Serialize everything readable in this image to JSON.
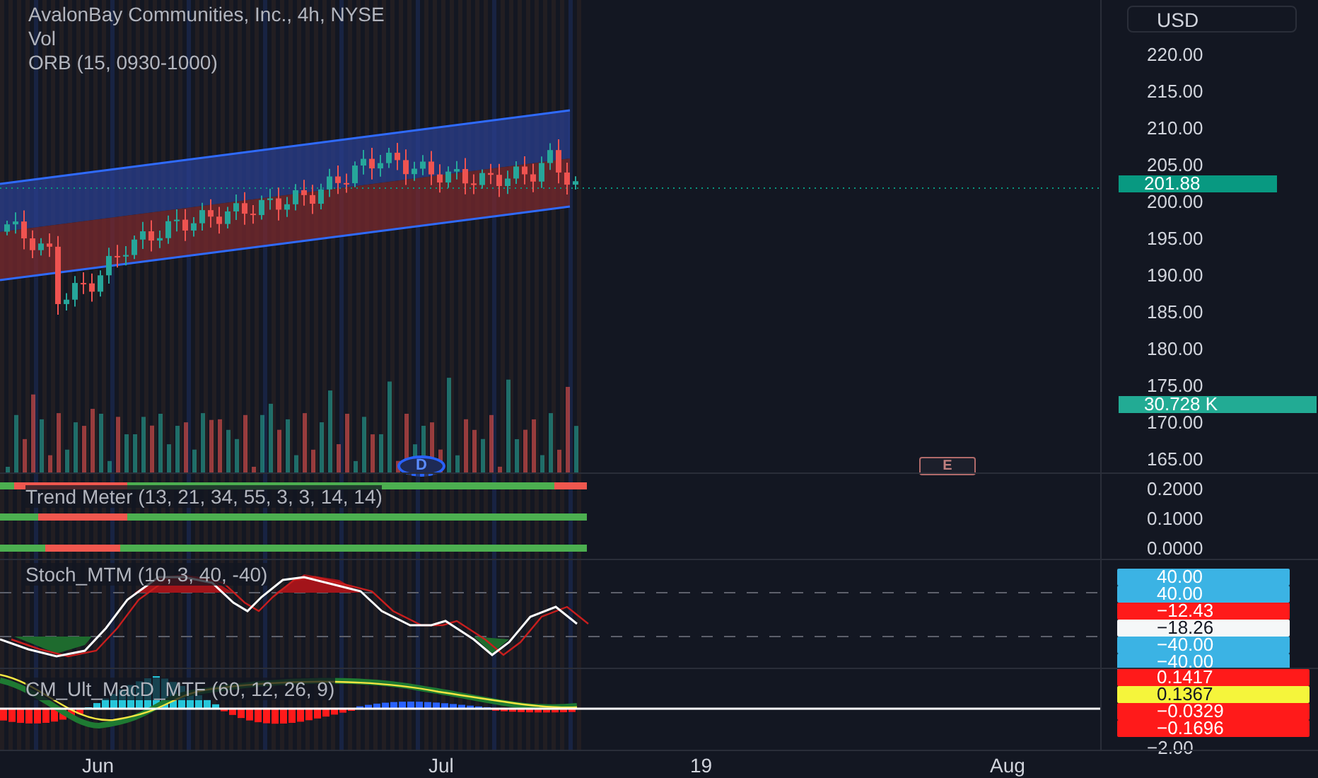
{
  "legend": {
    "title": "AvalonBay Communities, Inc., 4h, NYSE",
    "lines": [
      "Vol",
      "ORB (15, 0930-1000)"
    ]
  },
  "currency": "USD",
  "price_ticks": [
    "220.00",
    "215.00",
    "210.00",
    "205.00",
    "200.00",
    "195.00",
    "190.00",
    "185.00",
    "180.00",
    "175.00",
    "170.00",
    "165.00"
  ],
  "price_badges": [
    {
      "text": "201.88",
      "color": "#089981"
    },
    {
      "text": "30.728 K",
      "color": "#22ab94"
    }
  ],
  "markers": [
    {
      "kind": "dividend",
      "label": "D"
    },
    {
      "kind": "earnings",
      "label": "E"
    }
  ],
  "trend_meter": {
    "label": "Trend Meter (13, 21, 34, 55, 3, 3, 14, 14)",
    "ticks": [
      "0.2000",
      "0.1000",
      "0.0000"
    ]
  },
  "stoch": {
    "label": "Stoch_MTM (10, 3, 40, -40)",
    "badges": [
      {
        "text": "40.00",
        "color": "#3bb3e4"
      },
      {
        "text": "40.00",
        "color": "#3bb3e4"
      },
      {
        "text": "−12.43",
        "color": "#ff1a1a"
      },
      {
        "text": "−18.26",
        "color": "#f5f7f8"
      },
      {
        "text": "−40.00",
        "color": "#3bb3e4"
      },
      {
        "text": "−40.00",
        "color": "#3bb3e4"
      }
    ]
  },
  "macd": {
    "label": "CM_Ult_MacD_MTF (60, 12, 26, 9)",
    "badges": [
      {
        "text": "0.1417",
        "color": "#ff1a1a"
      },
      {
        "text": "0.1367",
        "color": "#f5f53b"
      },
      {
        "text": "−0.0329",
        "color": "#ff1a1a"
      },
      {
        "text": "−0.1696",
        "color": "#ff1a1a"
      }
    ],
    "ticks": [
      "−2.00"
    ]
  },
  "time_axis": [
    "Jun",
    "Jul",
    "19",
    "Aug"
  ]
}
